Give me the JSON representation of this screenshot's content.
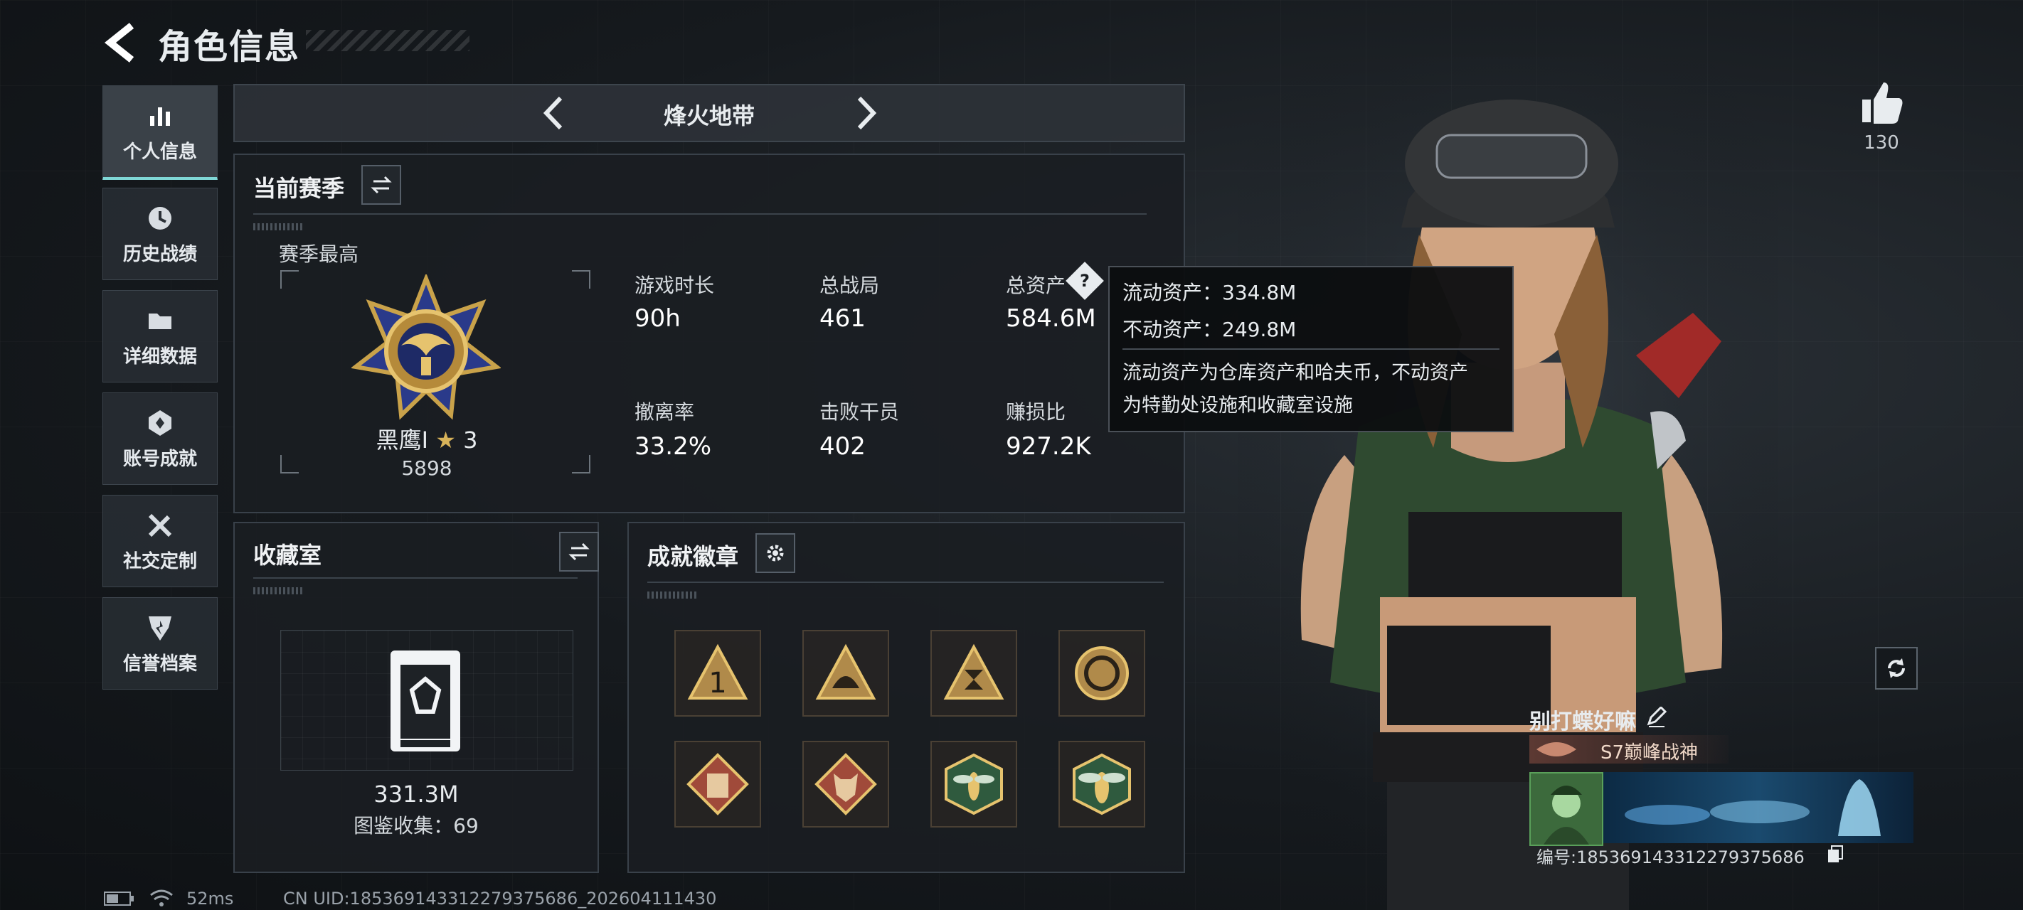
{
  "header": {
    "title": "角色信息"
  },
  "sidebar": {
    "items": [
      {
        "label": "个人信息",
        "icon": "bar-chart-icon",
        "active": true
      },
      {
        "label": "历史战绩",
        "icon": "clock-icon"
      },
      {
        "label": "详细数据",
        "icon": "folder-icon"
      },
      {
        "label": "账号成就",
        "icon": "achievement-icon"
      },
      {
        "label": "社交定制",
        "icon": "tools-icon"
      },
      {
        "label": "信誉档案",
        "icon": "shield-icon"
      }
    ]
  },
  "mode": {
    "name": "烽火地带"
  },
  "season": {
    "title": "当前赛季",
    "best_label": "赛季最高",
    "rank_name": "黑鹰I",
    "rank_star": "★",
    "rank_stars": "3",
    "rank_score": "5898",
    "stats": [
      {
        "label": "游戏时长",
        "value": "90h"
      },
      {
        "label": "总战局",
        "value": "461"
      },
      {
        "label": "总资产",
        "value": "584.6M"
      },
      {
        "label": "撤离率",
        "value": "33.2%"
      },
      {
        "label": "击败干员",
        "value": "402"
      },
      {
        "label": "赚损比",
        "value": "927.2K"
      }
    ],
    "help_glyph": "?"
  },
  "tooltip": {
    "line1": "流动资产：334.8M",
    "line2": "不动资产：249.8M",
    "line3": "流动资产为仓库资产和哈夫币，不动资产",
    "line4": "为特勤处设施和收藏室设施"
  },
  "collection": {
    "title": "收藏室",
    "value": "331.3M",
    "catalog": "图鉴收集：69"
  },
  "badges": {
    "title": "成就徽章",
    "items": [
      "rank-one-badge",
      "helmet-badge",
      "hourglass-badge",
      "ring-badge",
      "armor-badge",
      "wolf-badge",
      "wasp-badge",
      "hornet-badge"
    ]
  },
  "profile": {
    "likes": "130",
    "player_name": "别打蝶好嘛",
    "title_badge": "S7巅峰战神",
    "player_id": "编号:185369143312279375686"
  },
  "status": {
    "ping": "52ms",
    "uid": "CN UID:185369143312279375686_202604111430"
  },
  "colors": {
    "accent": "#7fd7d6",
    "panel": "#1a1e22",
    "gold": "#c9a24a"
  }
}
